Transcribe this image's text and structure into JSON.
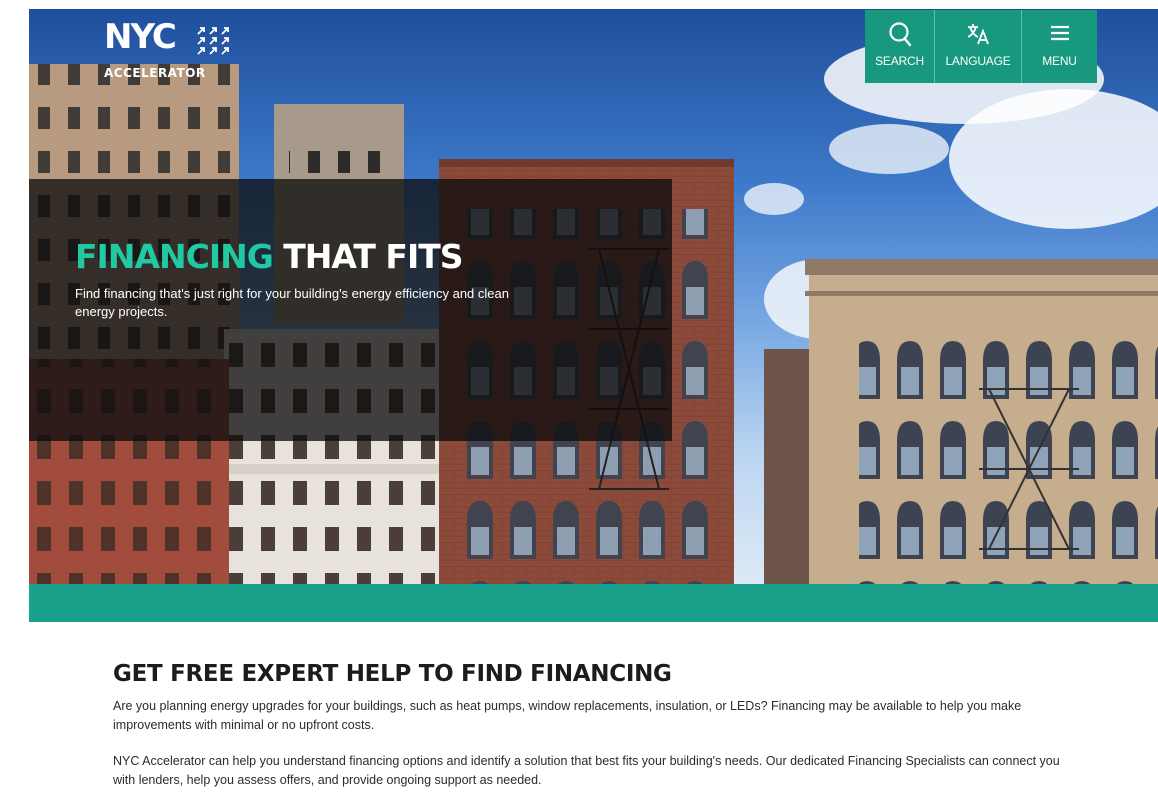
{
  "brand": {
    "logo_word": "NYC",
    "logo_subtitle": "ACCELERATOR",
    "accent_color": "#20c9a4",
    "nav_color": "#17987f"
  },
  "utility_nav": [
    {
      "label": "SEARCH",
      "icon": "search-icon"
    },
    {
      "label": "LANGUAGE",
      "icon": "translate-icon"
    },
    {
      "label": "MENU",
      "icon": "hamburger-icon"
    }
  ],
  "hero": {
    "title_accent": "FINANCING",
    "title_rest": " THAT FITS",
    "description": "Find financing that's just right for your building's energy efficiency and clean energy projects."
  },
  "intro": {
    "heading": "GET FREE EXPERT HELP TO FIND FINANCING",
    "paragraphs": [
      "Are you planning energy upgrades for your buildings, such as heat pumps, window replacements, insulation, or LEDs? Financing may be available to help you make improvements with minimal or no upfront costs.",
      "NYC Accelerator can help you understand financing options and identify a solution that best fits your building's needs. Our dedicated Financing Specialists can connect you with lenders, help you assess offers, and provide ongoing support as needed."
    ]
  }
}
